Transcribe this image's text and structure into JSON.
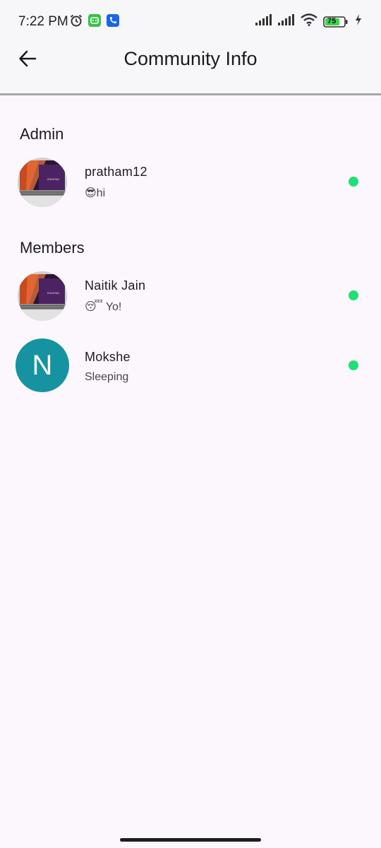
{
  "status_bar": {
    "time": "7:22 PM",
    "battery_level": "75",
    "icons_left": [
      "alarm-icon",
      "android-app-icon",
      "phone-app-icon"
    ],
    "icons_right": [
      "signal-icon",
      "signal-icon",
      "wifi-icon",
      "battery-icon",
      "charging-icon"
    ]
  },
  "app_bar": {
    "title": "Community Info",
    "back_icon": "back-arrow-icon"
  },
  "admin_section": {
    "heading": "Admin",
    "members": [
      {
        "name": "pratham12",
        "status": "😎hi",
        "online": true,
        "avatar": "laptop-photo"
      }
    ]
  },
  "members_section": {
    "heading": "Members",
    "members": [
      {
        "name": "Naitik Jain",
        "status": "😴 Yo!",
        "online": true,
        "avatar": "laptop-photo"
      },
      {
        "name": "Mokshe",
        "status": "Sleeping",
        "online": true,
        "avatar_letter": "N"
      }
    ]
  },
  "colors": {
    "background": "#fcf6fd",
    "app_bar": "#f7f7f9",
    "online": "#1ee074",
    "letter_avatar": "#1593a0"
  }
}
